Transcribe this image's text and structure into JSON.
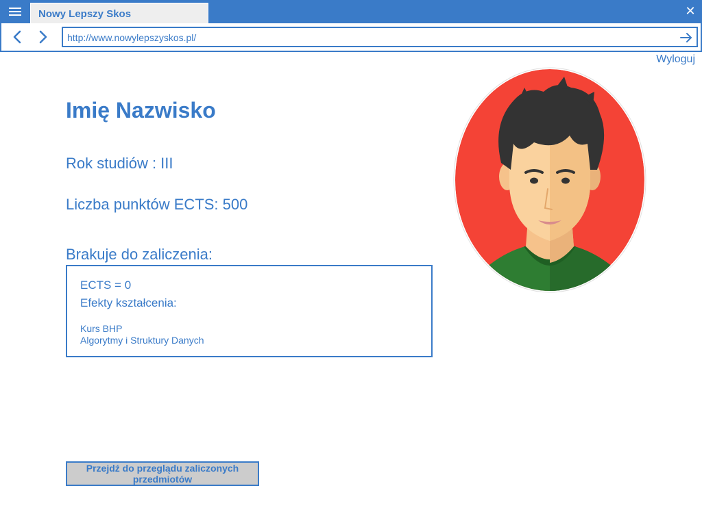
{
  "browser": {
    "tab_title": "Nowy Lepszy Skos",
    "url": "http://www.nowylepszyskos.pl/",
    "icons": [
      "menu-icon",
      "close-icon",
      "back-arrow-icon",
      "forward-arrow-icon",
      "go-arrow-icon"
    ]
  },
  "header": {
    "logout_label": "Wyloguj"
  },
  "profile": {
    "name": "Imię Nazwisko",
    "year_of_study": "Rok studiów : III",
    "ects_points": "Liczba punktów ECTS: 500",
    "avatar": "avatar-image"
  },
  "missing": {
    "heading": "Brakuje do zaliczenia:",
    "ects": "ECTS = 0",
    "effects_label": "Efekty kształcenia:",
    "courses": [
      "Kurs BHP",
      "Algorytmy i Struktury Danych"
    ]
  },
  "actions": {
    "review_button_label": "Przejdź do przeglądu zaliczonych przedmiotów"
  },
  "colors": {
    "accent": "#3a7bc8",
    "button_bg": "#cccccc",
    "avatar_bg": "#f44336"
  }
}
